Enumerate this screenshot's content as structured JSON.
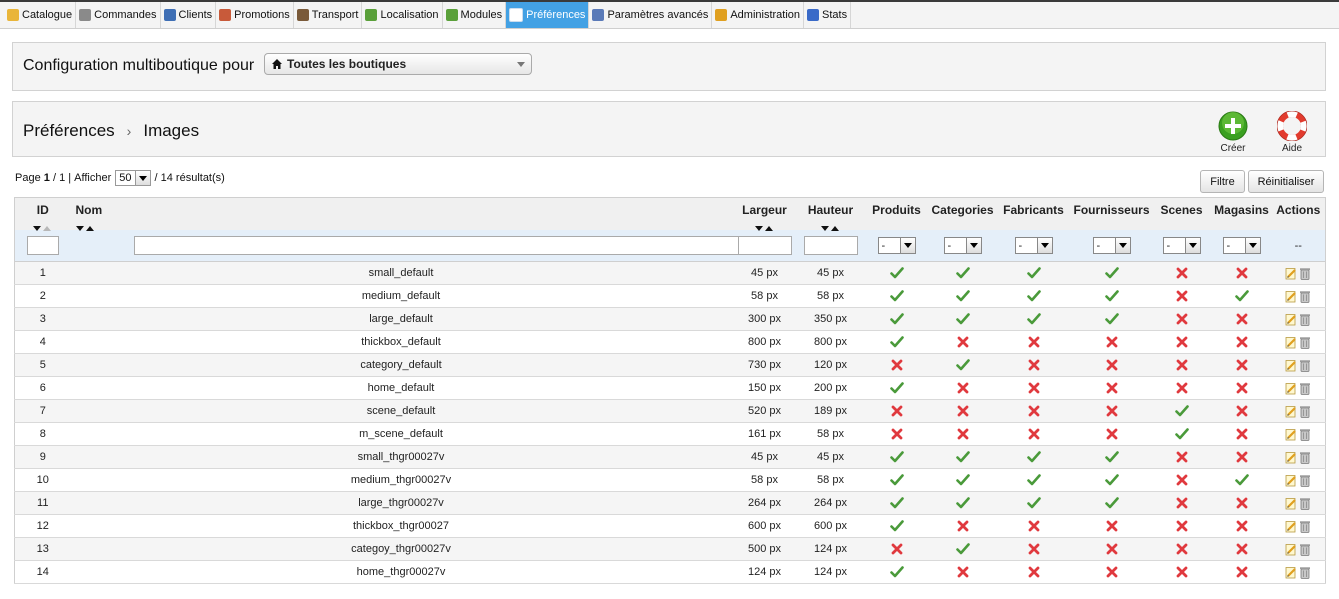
{
  "nav": {
    "items": [
      {
        "label": "Catalogue",
        "icon": "folder-icon",
        "active": false
      },
      {
        "label": "Commandes",
        "icon": "cart-icon",
        "active": false
      },
      {
        "label": "Clients",
        "icon": "user-icon",
        "active": false
      },
      {
        "label": "Promotions",
        "icon": "promotion-icon",
        "active": false
      },
      {
        "label": "Transport",
        "icon": "truck-icon",
        "active": false
      },
      {
        "label": "Localisation",
        "icon": "globe-icon",
        "active": false
      },
      {
        "label": "Modules",
        "icon": "puzzle-icon",
        "active": false
      },
      {
        "label": "Préférences",
        "icon": "preferences-icon",
        "active": true
      },
      {
        "label": "Paramètres avancés",
        "icon": "wrench-icon",
        "active": false
      },
      {
        "label": "Administration",
        "icon": "key-icon",
        "active": false
      },
      {
        "label": "Stats",
        "icon": "bar-chart-icon",
        "active": false
      }
    ]
  },
  "multishop": {
    "label": "Configuration multiboutique pour",
    "selected": "Toutes les boutiques"
  },
  "breadcrumb": {
    "parent": "Préférences",
    "separator": "›",
    "current": "Images"
  },
  "toolbar": {
    "create_label": "Créer",
    "help_label": "Aide"
  },
  "pagination": {
    "page_word": "Page",
    "current_page": "1",
    "total_pages": "1",
    "show_word": "Afficher",
    "per_page": "50",
    "results": "/ 14 résultat(s)"
  },
  "actions": {
    "filter_label": "Filtre",
    "reset_label": "Réinitialiser"
  },
  "table": {
    "columns": {
      "id": "ID",
      "name": "Nom",
      "width": "Largeur",
      "height": "Hauteur",
      "products": "Produits",
      "categories": "Categories",
      "manufacturers": "Fabricants",
      "suppliers": "Fournisseurs",
      "scenes": "Scenes",
      "stores": "Magasins",
      "actions": "Actions"
    },
    "filter_select_value": "-",
    "actions_placeholder": "--",
    "rows": [
      {
        "id": "1",
        "name": "small_default",
        "width": "45 px",
        "height": "45 px",
        "flags": [
          true,
          true,
          true,
          true,
          false,
          false
        ]
      },
      {
        "id": "2",
        "name": "medium_default",
        "width": "58 px",
        "height": "58 px",
        "flags": [
          true,
          true,
          true,
          true,
          false,
          true
        ]
      },
      {
        "id": "3",
        "name": "large_default",
        "width": "300 px",
        "height": "350 px",
        "flags": [
          true,
          true,
          true,
          true,
          false,
          false
        ]
      },
      {
        "id": "4",
        "name": "thickbox_default",
        "width": "800 px",
        "height": "800 px",
        "flags": [
          true,
          false,
          false,
          false,
          false,
          false
        ]
      },
      {
        "id": "5",
        "name": "category_default",
        "width": "730 px",
        "height": "120 px",
        "flags": [
          false,
          true,
          false,
          false,
          false,
          false
        ]
      },
      {
        "id": "6",
        "name": "home_default",
        "width": "150 px",
        "height": "200 px",
        "flags": [
          true,
          false,
          false,
          false,
          false,
          false
        ]
      },
      {
        "id": "7",
        "name": "scene_default",
        "width": "520 px",
        "height": "189 px",
        "flags": [
          false,
          false,
          false,
          false,
          true,
          false
        ]
      },
      {
        "id": "8",
        "name": "m_scene_default",
        "width": "161 px",
        "height": "58 px",
        "flags": [
          false,
          false,
          false,
          false,
          true,
          false
        ]
      },
      {
        "id": "9",
        "name": "small_thgr00027v",
        "width": "45 px",
        "height": "45 px",
        "flags": [
          true,
          true,
          true,
          true,
          false,
          false
        ]
      },
      {
        "id": "10",
        "name": "medium_thgr00027v",
        "width": "58 px",
        "height": "58 px",
        "flags": [
          true,
          true,
          true,
          true,
          false,
          true
        ]
      },
      {
        "id": "11",
        "name": "large_thgr00027v",
        "width": "264 px",
        "height": "264 px",
        "flags": [
          true,
          true,
          true,
          true,
          false,
          false
        ]
      },
      {
        "id": "12",
        "name": "thickbox_thgr00027",
        "width": "600 px",
        "height": "600 px",
        "flags": [
          true,
          false,
          false,
          false,
          false,
          false
        ]
      },
      {
        "id": "13",
        "name": "categoy_thgr00027v",
        "width": "500 px",
        "height": "124 px",
        "flags": [
          false,
          true,
          false,
          false,
          false,
          false
        ]
      },
      {
        "id": "14",
        "name": "home_thgr00027v",
        "width": "124 px",
        "height": "124 px",
        "flags": [
          true,
          false,
          false,
          false,
          false,
          false
        ]
      }
    ]
  },
  "colors": {
    "active_tab": "#43a1e4",
    "check": "#4a9a3a",
    "cross": "#e0393e",
    "filter_row": "#e5eff9"
  }
}
